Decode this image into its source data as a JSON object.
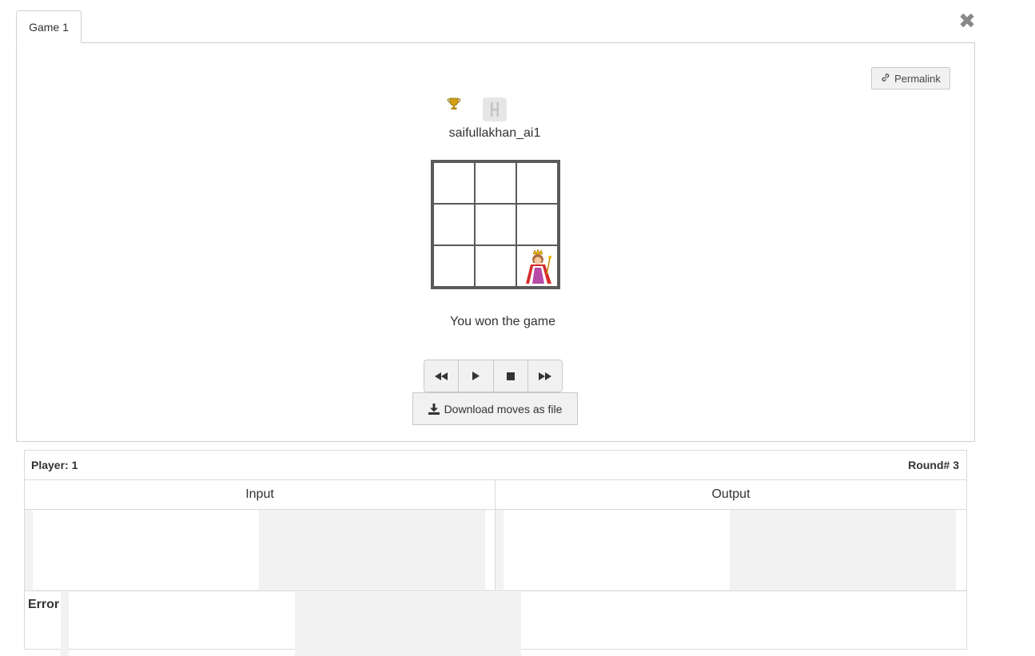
{
  "tabs": [
    {
      "label": "Game 1"
    }
  ],
  "close_label": "✖",
  "permalink_label": "Permalink",
  "player": {
    "name": "saifullakhan_ai1"
  },
  "board": {
    "rows": 3,
    "cols": 3,
    "queen_cell": [
      2,
      2
    ]
  },
  "status_message": "You won the game",
  "controls": [
    "rewind",
    "play",
    "stop",
    "fast-forward"
  ],
  "download_label": "Download moves as file",
  "details": {
    "player_label": "Player: 1",
    "round_label": "Round# 3",
    "input_label": "Input",
    "output_label": "Output",
    "error_label": "Error"
  },
  "colors": {
    "board_border": "#5a5a5a",
    "button_bg": "#f1f1f1",
    "trophy": "#d4a017"
  }
}
